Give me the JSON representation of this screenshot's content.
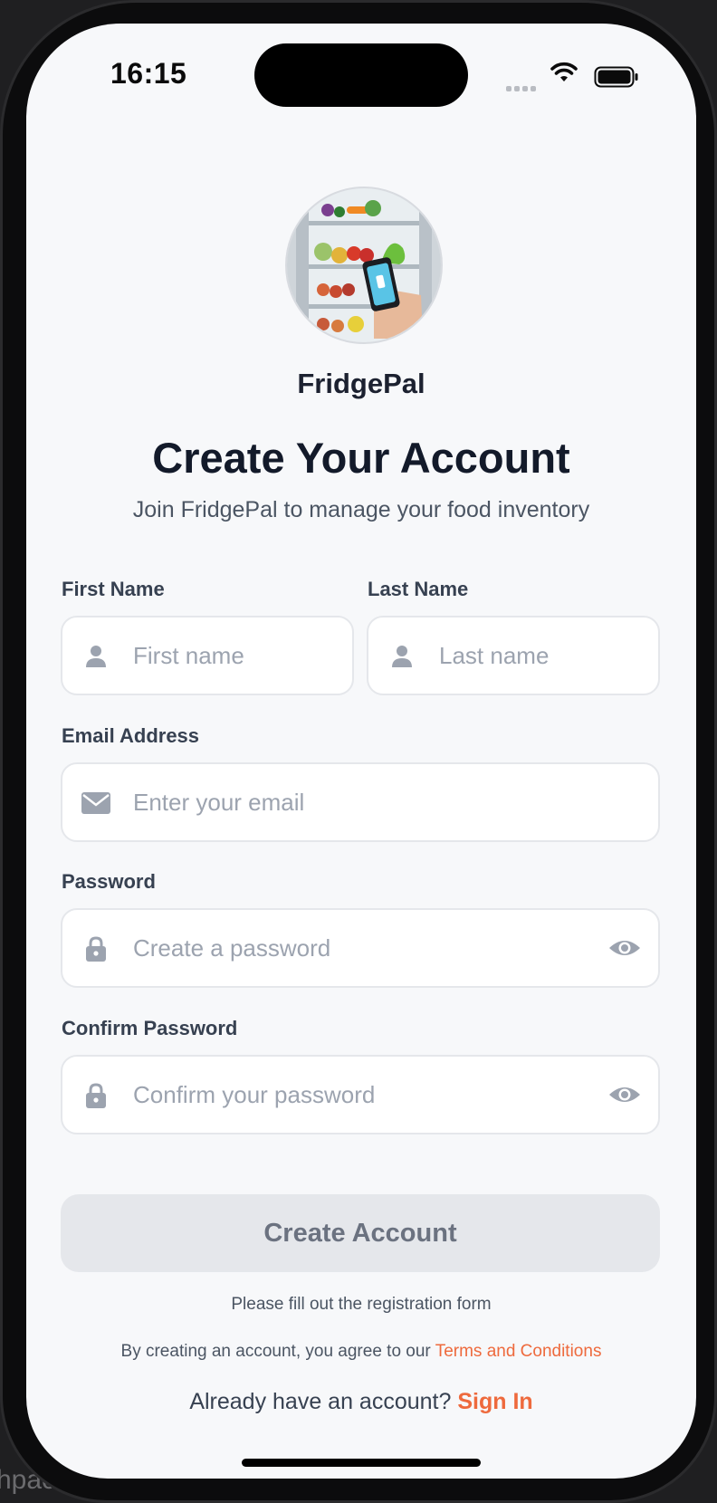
{
  "status_bar": {
    "time": "16:15"
  },
  "brand": {
    "app_name": "FridgePal"
  },
  "header": {
    "title": "Create Your Account",
    "subtitle": "Join FridgePal to manage your food inventory"
  },
  "form": {
    "first_name": {
      "label": "First Name",
      "placeholder": "First name",
      "value": ""
    },
    "last_name": {
      "label": "Last Name",
      "placeholder": "Last name",
      "value": ""
    },
    "email": {
      "label": "Email Address",
      "placeholder": "Enter your email",
      "value": ""
    },
    "password": {
      "label": "Password",
      "placeholder": "Create a password",
      "value": ""
    },
    "confirm_password": {
      "label": "Confirm Password",
      "placeholder": "Confirm your password",
      "value": ""
    }
  },
  "actions": {
    "create_label": "Create Account",
    "hint": "Please fill out the registration form"
  },
  "footer": {
    "terms_prefix": "By creating an account, you agree to our ",
    "terms_link": "Terms and Conditions",
    "signin_prefix": "Already have an account? ",
    "signin_link": "Sign In"
  },
  "background": {
    "fragment": "hpac"
  },
  "colors": {
    "accent": "#ee6a3d",
    "title": "#131a2a",
    "button_disabled_bg": "#e5e7eb",
    "button_disabled_text": "#6b7280",
    "screen_bg": "#f7f8fa"
  },
  "icons": [
    "person-icon",
    "mail-icon",
    "lock-icon",
    "eye-icon",
    "wifi-icon",
    "battery-icon",
    "signal-icon"
  ]
}
